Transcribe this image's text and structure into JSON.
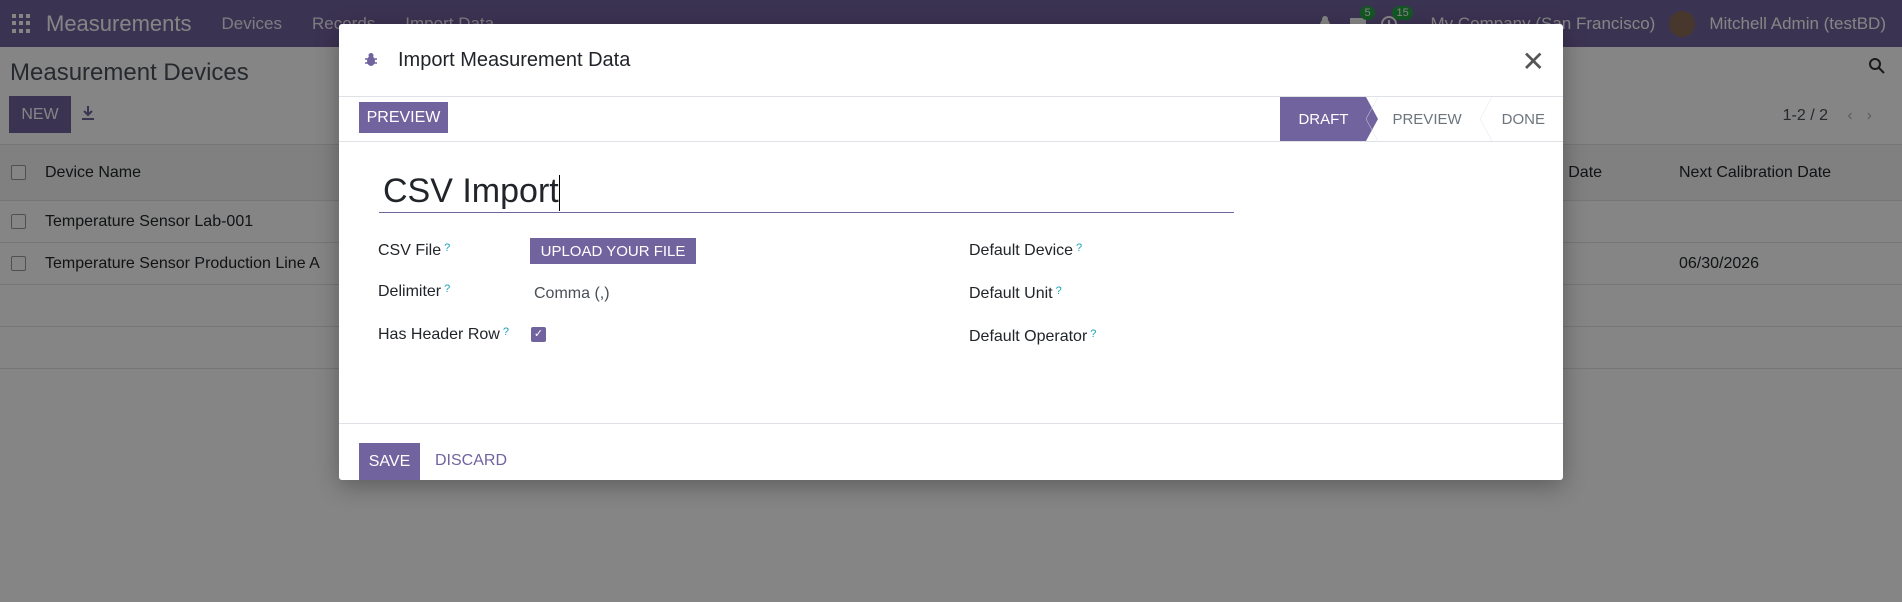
{
  "navbar": {
    "app_name": "Measurements",
    "menu": [
      "Devices",
      "Records",
      "Import Data"
    ],
    "messages_count": "5",
    "activities_count": "15",
    "company": "My Company (San Francisco)",
    "user": "Mitchell Admin (testBD)",
    "accent_color": "#71639e"
  },
  "control_panel": {
    "title": "Measurement Devices",
    "new_label": "NEW",
    "pager": "1-2 / 2"
  },
  "list": {
    "headers": [
      "Device Name",
      "on Date",
      "Next Calibration Date"
    ],
    "rows": [
      {
        "name": "Temperature Sensor Lab-001",
        "next_calibration": ""
      },
      {
        "name": "Temperature Sensor Production Line A",
        "next_calibration": "06/30/2026"
      }
    ]
  },
  "modal": {
    "title": "Import Measurement Data",
    "preview_button": "PREVIEW",
    "stages": [
      "DRAFT",
      "PREVIEW",
      "DONE"
    ],
    "active_stage": "DRAFT",
    "name_value": "CSV Import",
    "fields": {
      "csv_file_label": "CSV File",
      "upload_label": "UPLOAD YOUR FILE",
      "delimiter_label": "Delimiter",
      "delimiter_value": "Comma (,)",
      "header_row_label": "Has Header Row",
      "header_row_checked": true,
      "default_device_label": "Default Device",
      "default_unit_label": "Default Unit",
      "default_operator_label": "Default Operator",
      "help_mark": "?"
    },
    "save_label": "SAVE",
    "discard_label": "DISCARD"
  }
}
